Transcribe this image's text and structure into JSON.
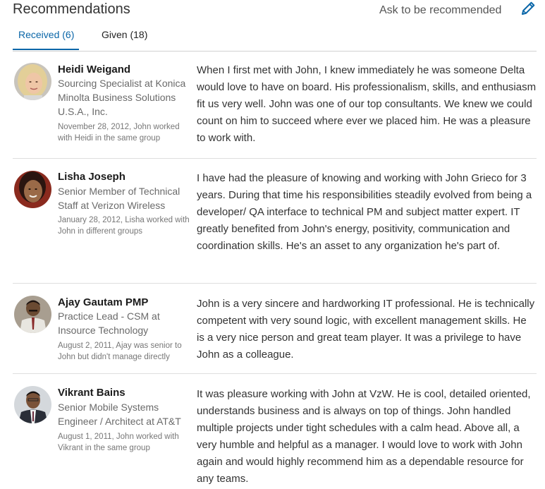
{
  "header": {
    "title": "Recommendations",
    "ask_label": "Ask to be recommended",
    "edit_icon": "pencil-icon",
    "accent_color": "#0a66a8"
  },
  "tabs": [
    {
      "label": "Received (6)",
      "active": true
    },
    {
      "label": "Given (18)",
      "active": false
    }
  ],
  "recommendations": [
    {
      "name": "Heidi Weigand",
      "headline": "Sourcing Specialist at Konica Minolta Business Solutions U.S.A., Inc.",
      "meta": "November 28, 2012, John worked with Heidi in the same group",
      "text": "When I first met with John, I knew immediately he was someone Delta would love to have on board. His professionalism, skills, and enthusiasm fit us very well. John was one of our top consultants. We knew we could count on him to succeed where ever we placed him. He was a pleasure to work with."
    },
    {
      "name": "Lisha Joseph",
      "headline": "Senior Member of Technical Staff at Verizon Wireless",
      "meta": "January 28, 2012, Lisha worked with John in different groups",
      "text": "I have had the pleasure of knowing and working with John Grieco for 3 years. During that time his responsibilities steadily evolved from being a developer/ QA interface to technical PM and subject matter expert. IT greatly benefited from John's energy, positivity, communication and coordination skills. He's an asset to any organization he's part of."
    },
    {
      "name": "Ajay Gautam PMP",
      "headline": "Practice Lead - CSM at Insource Technology",
      "meta": "August 2, 2011, Ajay was senior to John but didn't manage directly",
      "text": "John is a very sincere and hardworking IT professional. He is technically competent with very sound logic, with excellent management skills. He is a very nice person and great team player. It was a privilege to have John as a colleague."
    },
    {
      "name": "Vikrant Bains",
      "headline": "Senior Mobile Systems Engineer / Architect at AT&T",
      "meta": "August 1, 2011, John worked with Vikrant in the same group",
      "text": "It was pleasure working with John at VzW. He is cool, detailed oriented, understands business and is always on top of things. John handled multiple projects under tight schedules with a calm head. Above all, a very humble and helpful as a manager. I would love to work with John again and would highly recommend him as a dependable resource for any teams."
    }
  ]
}
